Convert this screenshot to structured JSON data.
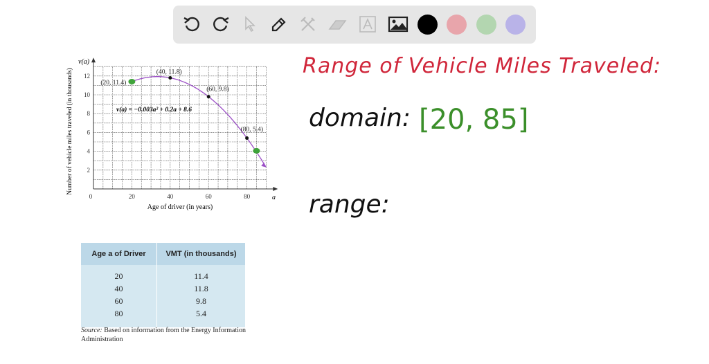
{
  "toolbar": {
    "tools": [
      "undo-icon",
      "redo-icon",
      "pointer-icon",
      "pen-icon",
      "tools-icon",
      "eraser-icon",
      "text-icon",
      "image-icon"
    ],
    "colors": [
      "#000000",
      "#e8a5ab",
      "#b3d6b0",
      "#b9b3e8"
    ]
  },
  "handwriting": {
    "title": "Range of Vehicle Miles Traveled:",
    "domain_label": "domain:",
    "domain_value": "[20, 85]",
    "range_label": "range:",
    "title_color": "#d0263a",
    "domain_value_color": "#3b8f2a"
  },
  "chart_data": {
    "type": "line",
    "ylabel_short": "v(a)",
    "xlabel_short": "a",
    "ylabel": "Number of vehicle miles traveled (in thousands)",
    "xlabel": "Age of driver (in years)",
    "equation": "v(a) = −0.003a² + 0.2a + 8.6",
    "xlim": [
      0,
      90
    ],
    "ylim": [
      0,
      13
    ],
    "xticks": [
      0,
      20,
      40,
      60,
      80
    ],
    "yticks": [
      2,
      4,
      6,
      8,
      10,
      12
    ],
    "grid": true,
    "curve": {
      "a": -0.003,
      "b": 0.2,
      "c": 8.6,
      "from": 20,
      "to": 90,
      "color": "#9b4fc6"
    },
    "points": [
      {
        "x": 20,
        "y": 11.4,
        "label": "(20, 11.4)"
      },
      {
        "x": 40,
        "y": 11.8,
        "label": "(40, 11.8)"
      },
      {
        "x": 60,
        "y": 9.8,
        "label": "(60, 9.8)"
      },
      {
        "x": 80,
        "y": 5.4,
        "label": "(80, 5.4)"
      }
    ],
    "highlights": [
      {
        "x": 20,
        "y": 11.4
      },
      {
        "x": 85,
        "y": 4.05
      }
    ]
  },
  "table": {
    "headers": [
      "Age a of Driver",
      "VMT (in thousands)"
    ],
    "rows": [
      [
        "20",
        "11.4"
      ],
      [
        "40",
        "11.8"
      ],
      [
        "60",
        "9.8"
      ],
      [
        "80",
        "5.4"
      ]
    ],
    "source_label": "Source:",
    "source_text": " Based on information from the Energy Information Administration"
  }
}
